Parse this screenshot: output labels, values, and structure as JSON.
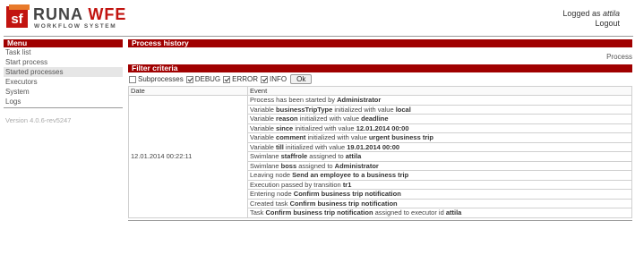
{
  "header": {
    "brand_runa": "RUNA",
    "brand_wfe": "WFE",
    "tagline": "WORKFLOW SYSTEM",
    "logged_as_prefix": "Logged as",
    "username": "attila",
    "logout": "Logout"
  },
  "sidebar": {
    "title": "Menu",
    "items": [
      {
        "label": "Task list"
      },
      {
        "label": "Start process"
      },
      {
        "label": "Started processes"
      },
      {
        "label": "Executors"
      },
      {
        "label": "System"
      },
      {
        "label": "Logs"
      }
    ],
    "version": "Version 4.0.6-rev5247"
  },
  "main": {
    "title": "Process history",
    "tab_label": "Process",
    "filter": {
      "title": "Filter criteria",
      "options": [
        {
          "label": "Subprocesses",
          "checked": false
        },
        {
          "label": "DEBUG",
          "checked": true
        },
        {
          "label": "ERROR",
          "checked": true
        },
        {
          "label": "INFO",
          "checked": true
        }
      ],
      "ok_label": "Ok"
    },
    "table": {
      "columns": [
        "Date",
        "Event"
      ],
      "date": "12.01.2014 00:22:11",
      "events": [
        [
          {
            "t": "Process has been started by "
          },
          {
            "t": "Administrator",
            "b": true
          }
        ],
        [
          {
            "t": "Variable "
          },
          {
            "t": "businessTripType",
            "b": true
          },
          {
            "t": " initialized with value "
          },
          {
            "t": "local",
            "b": true
          }
        ],
        [
          {
            "t": "Variable "
          },
          {
            "t": "reason",
            "b": true
          },
          {
            "t": " initialized with value "
          },
          {
            "t": "deadline",
            "b": true
          }
        ],
        [
          {
            "t": "Variable "
          },
          {
            "t": "since",
            "b": true
          },
          {
            "t": " initialized with value "
          },
          {
            "t": "12.01.2014 00:00",
            "b": true
          }
        ],
        [
          {
            "t": "Variable "
          },
          {
            "t": "comment",
            "b": true
          },
          {
            "t": " initialized with value "
          },
          {
            "t": "urgent business trip",
            "b": true
          }
        ],
        [
          {
            "t": "Variable "
          },
          {
            "t": "till",
            "b": true
          },
          {
            "t": " initialized with value "
          },
          {
            "t": "19.01.2014 00:00",
            "b": true
          }
        ],
        [
          {
            "t": "Swimlane "
          },
          {
            "t": "staffrole",
            "b": true
          },
          {
            "t": " assigned to "
          },
          {
            "t": "attila",
            "b": true
          }
        ],
        [
          {
            "t": "Swimlane "
          },
          {
            "t": "boss",
            "b": true
          },
          {
            "t": " assigned to "
          },
          {
            "t": "Administrator",
            "b": true
          }
        ],
        [
          {
            "t": "Leaving node "
          },
          {
            "t": "Send an employee to a business trip",
            "b": true
          }
        ],
        [
          {
            "t": "Execution passed by transition "
          },
          {
            "t": "tr1",
            "b": true
          }
        ],
        [
          {
            "t": "Entering node "
          },
          {
            "t": "Confirm business trip notification",
            "b": true
          }
        ],
        [
          {
            "t": "Created task "
          },
          {
            "t": "Confirm business trip notification",
            "b": true
          }
        ],
        [
          {
            "t": "Task "
          },
          {
            "t": "Confirm business trip notification",
            "b": true
          },
          {
            "t": " assigned to executor id "
          },
          {
            "t": "attila",
            "b": true
          }
        ]
      ]
    }
  },
  "colors": {
    "accent": "#a00000",
    "brand_red": "#c21410"
  }
}
